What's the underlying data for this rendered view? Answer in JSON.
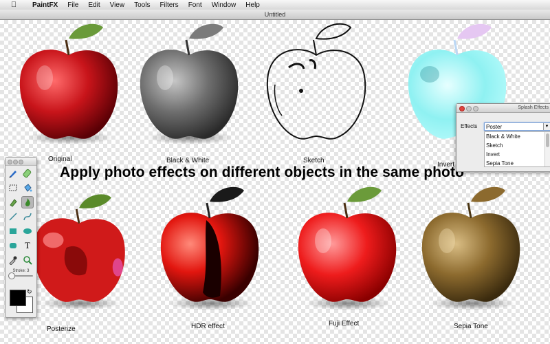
{
  "menubar": {
    "app_name": "PaintFX",
    "items": [
      "File",
      "Edit",
      "View",
      "Tools",
      "Filters",
      "Font",
      "Window",
      "Help"
    ]
  },
  "window": {
    "title": "Untitled"
  },
  "headline": "Apply photo effects on different objects in the same photo",
  "apples_top": [
    {
      "caption": "Original",
      "body": "#c8141a",
      "leaf": "#6a9a3a"
    },
    {
      "caption": "Black & White",
      "body": "#6e6e6e",
      "leaf": "#7b7b7b"
    },
    {
      "caption": "Sketch",
      "body": "none",
      "leaf": "none"
    },
    {
      "caption": "Invert",
      "body": "#8ff1f2",
      "leaf": "#e5c7f2"
    }
  ],
  "apples_bottom": [
    {
      "caption": "Posterize",
      "body": "#d01a1a",
      "leaf": "#5a8a2a"
    },
    {
      "caption": "HDR effect",
      "body": "#e2160f",
      "leaf": "#1a1a1a"
    },
    {
      "caption": "Fuji Effect",
      "body": "#ee1c1c",
      "leaf": "#6b9b3a"
    },
    {
      "caption": "Sepia Tone",
      "body": "#8c6a2e",
      "leaf": "#8c6a2e"
    }
  ],
  "palette": {
    "stroke_label": "Stroke: 3",
    "foreground_color": "#000000",
    "background_color": "#ffffff",
    "tools": [
      "brush-icon",
      "eraser-icon",
      "marquee-icon",
      "bucket-icon",
      "smudge-icon",
      "flame-icon",
      "line-icon",
      "curve-icon",
      "rectangle-icon",
      "ellipse-icon",
      "rounded-rect-icon",
      "text-icon",
      "eyedropper-icon",
      "zoom-icon"
    ],
    "text_tool_glyph": "T"
  },
  "splash": {
    "title": "Splash Effects",
    "effects_label": "Effects",
    "selected": "Poster",
    "options": [
      "Black & White",
      "Sketch",
      "Invert",
      "Sepia Tone"
    ]
  }
}
